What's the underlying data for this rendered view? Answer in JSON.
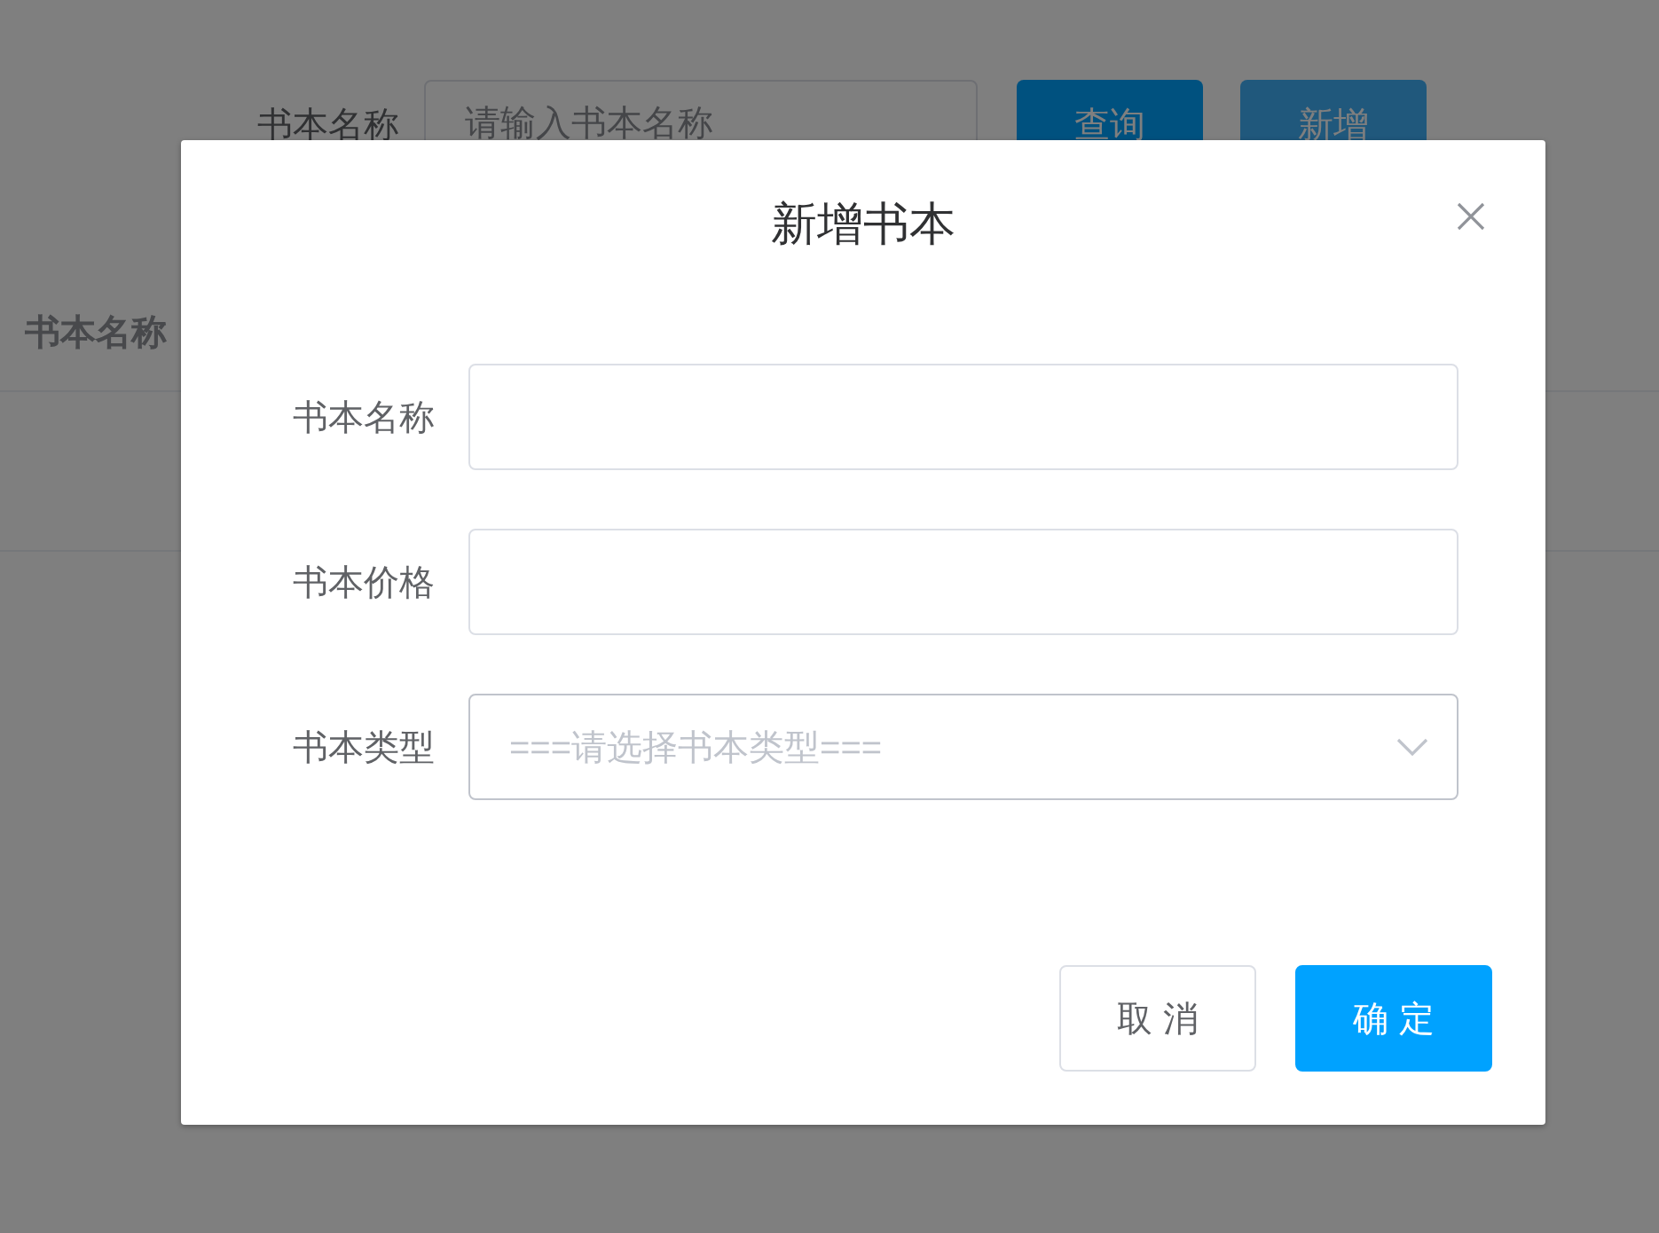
{
  "page": {
    "search_label": "书本名称",
    "search_field": {
      "placeholder": "请输入书本名称"
    },
    "buttons": [
      {
        "label": "查询",
        "kind": "primary"
      },
      {
        "label": "新增",
        "kind": "secondary"
      }
    ],
    "table": {
      "columns": [
        "书本名称"
      ]
    }
  },
  "dialog": {
    "title": "新增书本",
    "fields": [
      {
        "label": "书本名称",
        "kind": "input"
      },
      {
        "label": "书本价格",
        "kind": "input"
      },
      {
        "label": "书本类型",
        "kind": "select",
        "placeholder": "===请选择书本类型==="
      }
    ],
    "buttons": [
      {
        "label": "取 消",
        "kind": "default"
      },
      {
        "label": "确 定",
        "kind": "primary"
      }
    ]
  }
}
